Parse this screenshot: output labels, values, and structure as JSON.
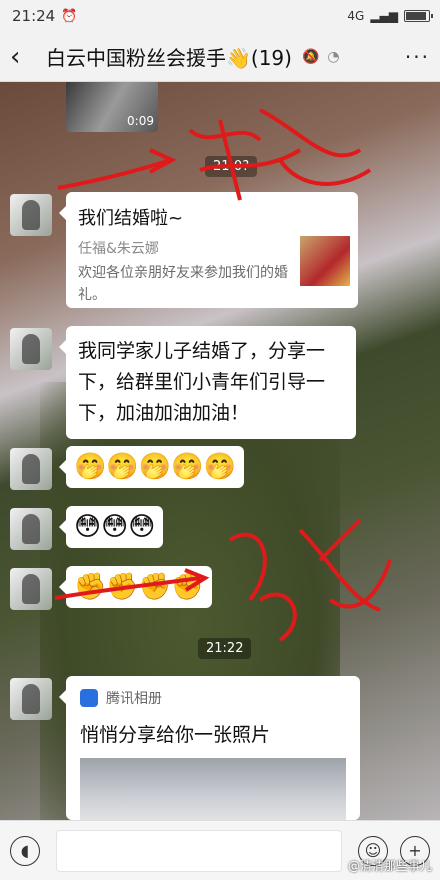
{
  "status_bar": {
    "time": "21:24",
    "alarm_icon": "alarm-clock-icon",
    "signal_text": "4G",
    "battery_level": 0.85
  },
  "header": {
    "back_icon": "back-arrow-icon",
    "title": "白云中国粉丝会援手👋(19)",
    "more_label": "···"
  },
  "messages": [
    {
      "type": "video",
      "duration": "0:09"
    },
    {
      "type": "time",
      "text": "21:0?"
    },
    {
      "type": "card",
      "title": "我们结婚啦~",
      "subtitle": "任福&朱云娜",
      "description": "欢迎各位亲朋好友来参加我们的婚礼。"
    },
    {
      "type": "text",
      "text": "我同学家儿子结婚了，分享一下，给群里们小青年们引导一下，加油加油加油！"
    },
    {
      "type": "emoji",
      "text": "🤭🤭🤭🤭🤭"
    },
    {
      "type": "emoji",
      "text": "😳😳😳"
    },
    {
      "type": "emoji",
      "text": "✊✊✊✊"
    },
    {
      "type": "time",
      "text": "21:22"
    },
    {
      "type": "share",
      "source": "腾讯相册",
      "headline": "悄悄分享给你一张照片"
    }
  ],
  "input_bar": {
    "voice_icon": "voice-icon",
    "emoji_icon": "emoji-icon",
    "plus_icon": "plus-icon",
    "watermark": "@清清那些事儿"
  }
}
